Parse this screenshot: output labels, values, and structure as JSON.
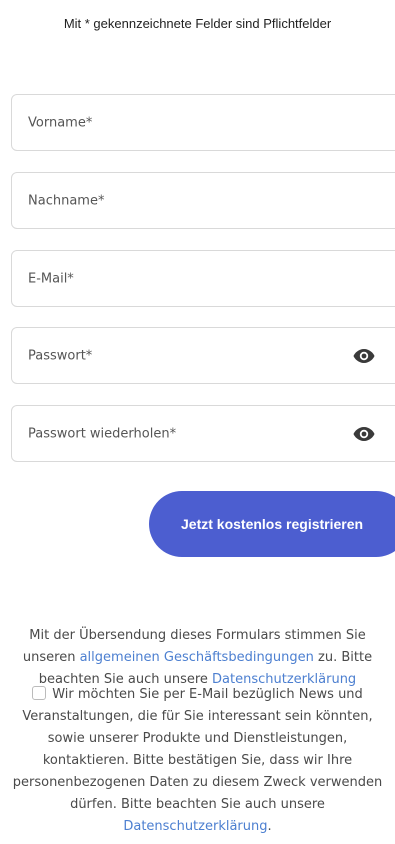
{
  "form": {
    "required_note": "Mit * gekennzeichnete Felder sind Pflichtfelder",
    "fields": [
      {
        "placeholder": "Vorname*",
        "value": ""
      },
      {
        "placeholder": "Nachname*",
        "value": ""
      },
      {
        "placeholder": "E-Mail*",
        "value": ""
      },
      {
        "placeholder": "Passwort*",
        "value": ""
      },
      {
        "placeholder": "Passwort wiederholen*",
        "value": ""
      }
    ],
    "password_toggle_icon": "eye-icon",
    "submit_label": "Jetzt kostenlos registrieren",
    "accent_color": "#4c5ed0",
    "link_color": "#4c7fd0"
  },
  "legal": {
    "text_1": "Mit der Übersendung dieses Formulars stimmen Sie unseren ",
    "terms_link": "allgemeinen Geschäftsbedingungen",
    "text_2": " zu. Bitte beachten Sie auch unsere ",
    "privacy_link": "Datenschutzerklärung"
  },
  "consent": {
    "checked": false,
    "text": "Wir möchten Sie per E-Mail bezüglich News und Veranstaltungen, die für Sie interessant sein könnten, sowie unserer Produkte und Dienstleistungen, kontaktieren. Bitte bestätigen Sie, dass wir Ihre personenbezogenen Daten zu diesem Zweck verwenden dürfen. Bitte beachten Sie auch unsere ",
    "privacy_link": "Datenschutzerklärung",
    "text_end": "."
  }
}
